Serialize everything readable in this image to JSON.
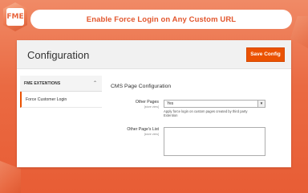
{
  "banner": {
    "title": "Enable Force Login on Any Custom URL"
  },
  "logo": {
    "mark": "FME",
    "icon": "fme-hexagon-logo"
  },
  "header": {
    "title": "Configuration",
    "save_label": "Save Config",
    "accent": "#eb5202"
  },
  "sidebar": {
    "group_label": "FME EXTENTIONS",
    "group_icon": "chevron-up-icon",
    "items": [
      {
        "label": "Force Customer Login",
        "active": true
      }
    ]
  },
  "main": {
    "section_title": "CMS Page Configuration",
    "fields": [
      {
        "label": "Other Pages",
        "scope": "[store view]",
        "value": "Yes",
        "note": "Apply force login on custom pages created by third party Extention"
      },
      {
        "label": "Other Page's List",
        "scope": "[store view]",
        "value": ""
      }
    ]
  }
}
